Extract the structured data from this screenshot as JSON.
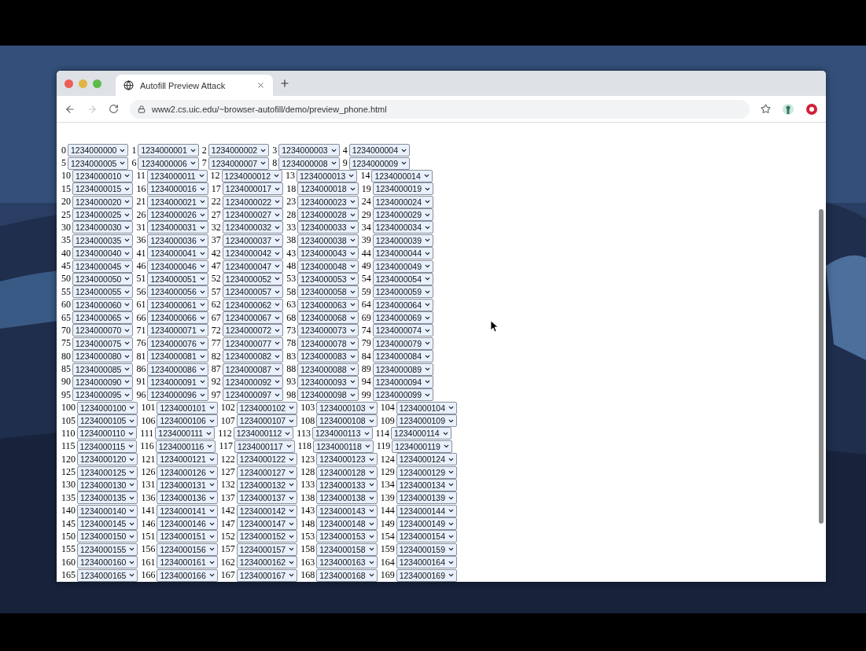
{
  "tab": {
    "title": "Autofill Preview Attack"
  },
  "address_bar": {
    "url": "www2.cs.uic.edu/~browser-autofill/demo/preview_phone.html"
  },
  "fields": [
    {
      "label": "0",
      "value": "1234000000"
    },
    {
      "label": "1",
      "value": "1234000001"
    },
    {
      "label": "2",
      "value": "1234000002"
    },
    {
      "label": "3",
      "value": "1234000003"
    },
    {
      "label": "4",
      "value": "1234000004"
    },
    {
      "label": "5",
      "value": "1234000005"
    },
    {
      "label": "6",
      "value": "1234000006"
    },
    {
      "label": "7",
      "value": "1234000007"
    },
    {
      "label": "8",
      "value": "1234000008"
    },
    {
      "label": "9",
      "value": "1234000009"
    },
    {
      "label": "10",
      "value": "1234000010"
    },
    {
      "label": "11",
      "value": "1234000011"
    },
    {
      "label": "12",
      "value": "1234000012"
    },
    {
      "label": "13",
      "value": "1234000013"
    },
    {
      "label": "14",
      "value": "1234000014"
    },
    {
      "label": "15",
      "value": "1234000015"
    },
    {
      "label": "16",
      "value": "1234000016"
    },
    {
      "label": "17",
      "value": "1234000017"
    },
    {
      "label": "18",
      "value": "1234000018"
    },
    {
      "label": "19",
      "value": "1234000019"
    },
    {
      "label": "20",
      "value": "1234000020"
    },
    {
      "label": "21",
      "value": "1234000021"
    },
    {
      "label": "22",
      "value": "1234000022"
    },
    {
      "label": "23",
      "value": "1234000023"
    },
    {
      "label": "24",
      "value": "1234000024"
    },
    {
      "label": "25",
      "value": "1234000025"
    },
    {
      "label": "26",
      "value": "1234000026"
    },
    {
      "label": "27",
      "value": "1234000027"
    },
    {
      "label": "28",
      "value": "1234000028"
    },
    {
      "label": "29",
      "value": "1234000029"
    },
    {
      "label": "30",
      "value": "1234000030"
    },
    {
      "label": "31",
      "value": "1234000031"
    },
    {
      "label": "32",
      "value": "1234000032"
    },
    {
      "label": "33",
      "value": "1234000033"
    },
    {
      "label": "34",
      "value": "1234000034"
    },
    {
      "label": "35",
      "value": "1234000035"
    },
    {
      "label": "36",
      "value": "1234000036"
    },
    {
      "label": "37",
      "value": "1234000037"
    },
    {
      "label": "38",
      "value": "1234000038"
    },
    {
      "label": "39",
      "value": "1234000039"
    },
    {
      "label": "40",
      "value": "1234000040"
    },
    {
      "label": "41",
      "value": "1234000041"
    },
    {
      "label": "42",
      "value": "1234000042"
    },
    {
      "label": "43",
      "value": "1234000043"
    },
    {
      "label": "44",
      "value": "1234000044"
    },
    {
      "label": "45",
      "value": "1234000045"
    },
    {
      "label": "46",
      "value": "1234000046"
    },
    {
      "label": "47",
      "value": "1234000047"
    },
    {
      "label": "48",
      "value": "1234000048"
    },
    {
      "label": "49",
      "value": "1234000049"
    },
    {
      "label": "50",
      "value": "1234000050"
    },
    {
      "label": "51",
      "value": "1234000051"
    },
    {
      "label": "52",
      "value": "1234000052"
    },
    {
      "label": "53",
      "value": "1234000053"
    },
    {
      "label": "54",
      "value": "1234000054"
    },
    {
      "label": "55",
      "value": "1234000055"
    },
    {
      "label": "56",
      "value": "1234000056"
    },
    {
      "label": "57",
      "value": "1234000057"
    },
    {
      "label": "58",
      "value": "1234000058"
    },
    {
      "label": "59",
      "value": "1234000059"
    },
    {
      "label": "60",
      "value": "1234000060"
    },
    {
      "label": "61",
      "value": "1234000061"
    },
    {
      "label": "62",
      "value": "1234000062"
    },
    {
      "label": "63",
      "value": "1234000063"
    },
    {
      "label": "64",
      "value": "1234000064"
    },
    {
      "label": "65",
      "value": "1234000065"
    },
    {
      "label": "66",
      "value": "1234000066"
    },
    {
      "label": "67",
      "value": "1234000067"
    },
    {
      "label": "68",
      "value": "1234000068"
    },
    {
      "label": "69",
      "value": "1234000069"
    },
    {
      "label": "70",
      "value": "1234000070"
    },
    {
      "label": "71",
      "value": "1234000071"
    },
    {
      "label": "72",
      "value": "1234000072"
    },
    {
      "label": "73",
      "value": "1234000073"
    },
    {
      "label": "74",
      "value": "1234000074"
    },
    {
      "label": "75",
      "value": "1234000075"
    },
    {
      "label": "76",
      "value": "1234000076"
    },
    {
      "label": "77",
      "value": "1234000077"
    },
    {
      "label": "78",
      "value": "1234000078"
    },
    {
      "label": "79",
      "value": "1234000079"
    },
    {
      "label": "80",
      "value": "1234000080"
    },
    {
      "label": "81",
      "value": "1234000081"
    },
    {
      "label": "82",
      "value": "1234000082"
    },
    {
      "label": "83",
      "value": "1234000083"
    },
    {
      "label": "84",
      "value": "1234000084"
    },
    {
      "label": "85",
      "value": "1234000085"
    },
    {
      "label": "86",
      "value": "1234000086"
    },
    {
      "label": "87",
      "value": "1234000087"
    },
    {
      "label": "88",
      "value": "1234000088"
    },
    {
      "label": "89",
      "value": "1234000089"
    },
    {
      "label": "90",
      "value": "1234000090"
    },
    {
      "label": "91",
      "value": "1234000091"
    },
    {
      "label": "92",
      "value": "1234000092"
    },
    {
      "label": "93",
      "value": "1234000093"
    },
    {
      "label": "94",
      "value": "1234000094"
    },
    {
      "label": "95",
      "value": "1234000095"
    },
    {
      "label": "96",
      "value": "1234000096"
    },
    {
      "label": "97",
      "value": "1234000097"
    },
    {
      "label": "98",
      "value": "1234000098"
    },
    {
      "label": "99",
      "value": "1234000099"
    },
    {
      "label": "100",
      "value": "1234000100"
    },
    {
      "label": "101",
      "value": "1234000101"
    },
    {
      "label": "102",
      "value": "1234000102"
    },
    {
      "label": "103",
      "value": "1234000103"
    },
    {
      "label": "104",
      "value": "1234000104"
    },
    {
      "label": "105",
      "value": "1234000105"
    },
    {
      "label": "106",
      "value": "1234000106"
    },
    {
      "label": "107",
      "value": "1234000107"
    },
    {
      "label": "108",
      "value": "1234000108"
    },
    {
      "label": "109",
      "value": "1234000109"
    },
    {
      "label": "110",
      "value": "1234000110"
    },
    {
      "label": "111",
      "value": "1234000111"
    },
    {
      "label": "112",
      "value": "1234000112"
    },
    {
      "label": "113",
      "value": "1234000113"
    },
    {
      "label": "114",
      "value": "1234000114"
    },
    {
      "label": "115",
      "value": "1234000115"
    },
    {
      "label": "116",
      "value": "1234000116"
    },
    {
      "label": "117",
      "value": "1234000117"
    },
    {
      "label": "118",
      "value": "1234000118"
    },
    {
      "label": "119",
      "value": "1234000119"
    },
    {
      "label": "120",
      "value": "1234000120"
    },
    {
      "label": "121",
      "value": "1234000121"
    },
    {
      "label": "122",
      "value": "1234000122"
    },
    {
      "label": "123",
      "value": "1234000123"
    },
    {
      "label": "124",
      "value": "1234000124"
    },
    {
      "label": "125",
      "value": "1234000125"
    },
    {
      "label": "126",
      "value": "1234000126"
    },
    {
      "label": "127",
      "value": "1234000127"
    },
    {
      "label": "128",
      "value": "1234000128"
    },
    {
      "label": "129",
      "value": "1234000129"
    },
    {
      "label": "130",
      "value": "1234000130"
    },
    {
      "label": "131",
      "value": "1234000131"
    },
    {
      "label": "132",
      "value": "1234000132"
    },
    {
      "label": "133",
      "value": "1234000133"
    },
    {
      "label": "134",
      "value": "1234000134"
    },
    {
      "label": "135",
      "value": "1234000135"
    },
    {
      "label": "136",
      "value": "1234000136"
    },
    {
      "label": "137",
      "value": "1234000137"
    },
    {
      "label": "138",
      "value": "1234000138"
    },
    {
      "label": "139",
      "value": "1234000139"
    },
    {
      "label": "140",
      "value": "1234000140"
    },
    {
      "label": "141",
      "value": "1234000141"
    },
    {
      "label": "142",
      "value": "1234000142"
    },
    {
      "label": "143",
      "value": "1234000143"
    },
    {
      "label": "144",
      "value": "1234000144"
    },
    {
      "label": "145",
      "value": "1234000145"
    },
    {
      "label": "146",
      "value": "1234000146"
    },
    {
      "label": "147",
      "value": "1234000147"
    },
    {
      "label": "148",
      "value": "1234000148"
    },
    {
      "label": "149",
      "value": "1234000149"
    },
    {
      "label": "150",
      "value": "1234000150"
    },
    {
      "label": "151",
      "value": "1234000151"
    },
    {
      "label": "152",
      "value": "1234000152"
    },
    {
      "label": "153",
      "value": "1234000153"
    },
    {
      "label": "154",
      "value": "1234000154"
    },
    {
      "label": "155",
      "value": "1234000155"
    },
    {
      "label": "156",
      "value": "1234000156"
    },
    {
      "label": "157",
      "value": "1234000157"
    },
    {
      "label": "158",
      "value": "1234000158"
    },
    {
      "label": "159",
      "value": "1234000159"
    },
    {
      "label": "160",
      "value": "1234000160"
    },
    {
      "label": "161",
      "value": "1234000161"
    },
    {
      "label": "162",
      "value": "1234000162"
    },
    {
      "label": "163",
      "value": "1234000163"
    },
    {
      "label": "164",
      "value": "1234000164"
    },
    {
      "label": "165",
      "value": "1234000165"
    },
    {
      "label": "166",
      "value": "1234000166"
    },
    {
      "label": "167",
      "value": "1234000167"
    },
    {
      "label": "168",
      "value": "1234000168"
    },
    {
      "label": "169",
      "value": "1234000169"
    }
  ]
}
